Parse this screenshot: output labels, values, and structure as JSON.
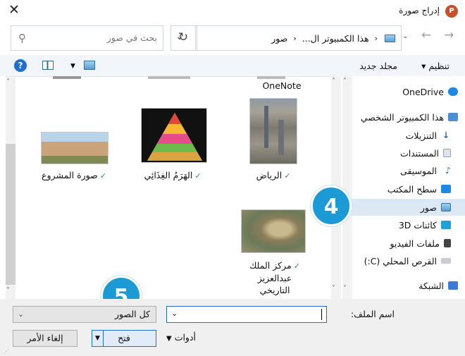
{
  "window": {
    "title": "إدراج صورة",
    "app_icon_letter": "P"
  },
  "address_bar": {
    "segments": [
      "هذا الكمبيوتر ال...",
      "صور"
    ]
  },
  "search": {
    "placeholder": "بحث في صور"
  },
  "toolbar": {
    "organize_label": "تنظيم",
    "new_folder_label": "مجلد جديد"
  },
  "nav_pane": {
    "items": [
      {
        "label": "OneDrive",
        "icon": "cloud-icon",
        "color": "#1e88e5"
      },
      {
        "label": "هذا الكمبيوتر الشخصي",
        "icon": "computer-icon",
        "color": "#4a90d9"
      },
      {
        "label": "التنزيلات",
        "icon": "download-icon",
        "color": "#1e6fd0"
      },
      {
        "label": "المستندات",
        "icon": "document-icon",
        "color": "#8fa4b8"
      },
      {
        "label": "الموسيقى",
        "icon": "music-icon",
        "color": "#1e6fd0"
      },
      {
        "label": "سطح المكتب",
        "icon": "desktop-icon",
        "color": "#1e88e5"
      },
      {
        "label": "صور",
        "icon": "pictures-icon",
        "color": "#3a6fa0"
      },
      {
        "label": "كائنات 3D",
        "icon": "cube-icon",
        "color": "#1ea0d8"
      },
      {
        "label": "ملفات الفيديو",
        "icon": "video-icon",
        "color": "#444444"
      },
      {
        "label": "القرص المحلي (C:)",
        "icon": "drive-icon",
        "color": "#7a8a99"
      },
      {
        "label": "الشبكة",
        "icon": "network-icon",
        "color": "#3a7bd5"
      }
    ],
    "selected_index": 6
  },
  "files": [
    {
      "label": "OneNote",
      "partial": true
    },
    {
      "label": "الرياض",
      "synced": true
    },
    {
      "label": "الهَرَمُ الغِذَائِي",
      "synced": true
    },
    {
      "label": "صورة المشروع",
      "synced": true
    },
    {
      "label_lines": [
        "مركز الملك",
        "عبدالعزيز",
        "التاريخي"
      ],
      "synced": true
    }
  ],
  "badges": {
    "step4": "4",
    "step5": "5"
  },
  "bottom": {
    "file_name_label": "اسم الملف:",
    "file_name_value": "",
    "file_type_value": "كل الصور",
    "tools_label": "أدوات",
    "open_label": "فتح",
    "cancel_label": "إلغاء الأمر"
  }
}
